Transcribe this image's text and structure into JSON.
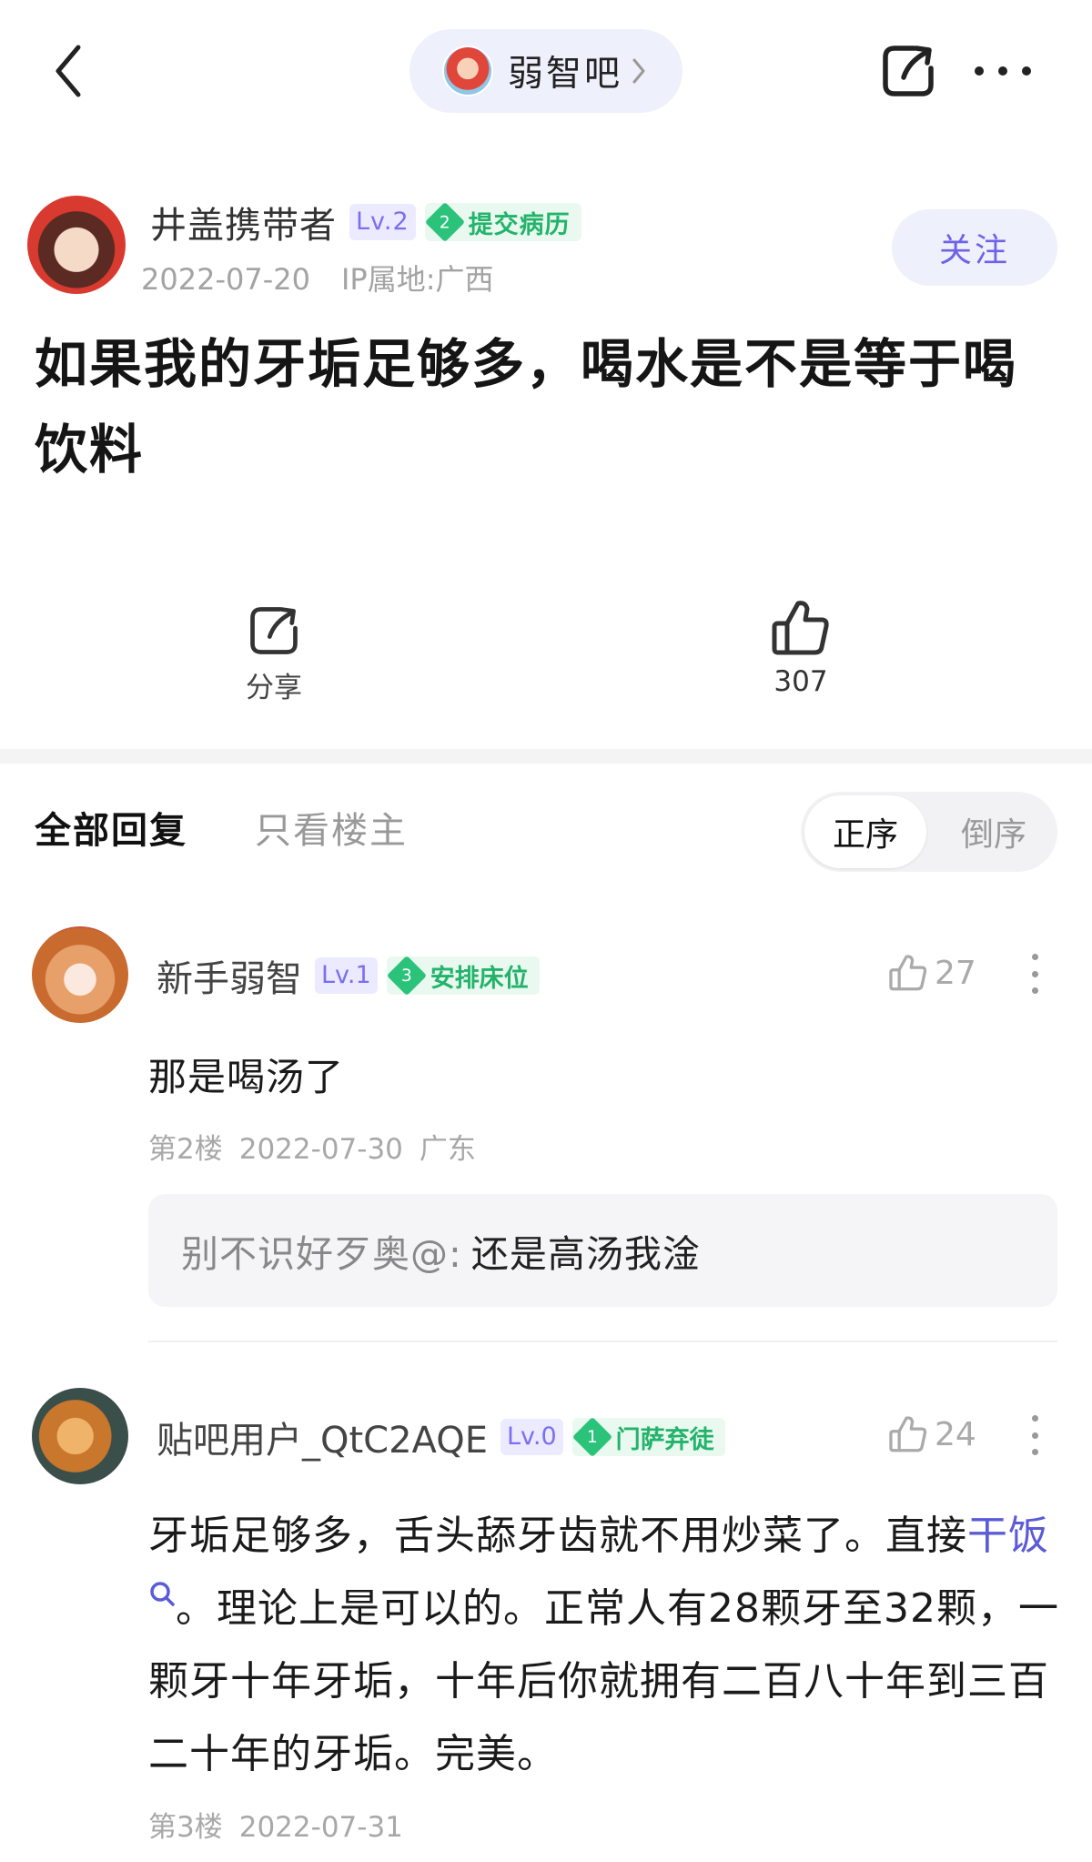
{
  "topbar": {
    "forum_name": "弱智吧"
  },
  "post": {
    "author": "井盖携带者",
    "level": "Lv.2",
    "honor_level": "2",
    "honor_title": "提交病历",
    "date": "2022-07-20",
    "ip": "IP属地:广西",
    "follow_label": "关注",
    "title": "如果我的牙垢足够多，喝水是不是等于喝饮料",
    "share_label": "分享",
    "like_count": "307"
  },
  "replies": {
    "tab_all": "全部回复",
    "tab_owner_only": "只看楼主",
    "sort_asc": "正序",
    "sort_desc": "倒序"
  },
  "comments": [
    {
      "author": "新手弱智",
      "level": "Lv.1",
      "honor_level": "3",
      "honor_title": "安排床位",
      "likes": "27",
      "text": "那是喝汤了",
      "floor": "第2楼",
      "date": "2022-07-30",
      "location": "广东",
      "sub_reply": {
        "author": "别不识好歹奥@:",
        "text": "还是高汤我淦"
      }
    },
    {
      "author": "贴吧用户_QtC2AQE",
      "level": "Lv.0",
      "honor_level": "1",
      "honor_title": "门萨弃徒",
      "likes": "24",
      "text_part1": "牙垢足够多，舌头舔牙齿就不用炒菜了。直接",
      "link_text": "干饭",
      "text_part2": "。理论上是可以的。正常人有28颗牙至32颗，一颗牙十年牙垢，十年后你就拥有二百八十年到三百二十年的牙垢。完美。",
      "floor": "第3楼",
      "date": "2022-07-31"
    }
  ],
  "icons": {
    "back": "chevron-left-icon",
    "forum_chevron": "chevron-right-icon",
    "share": "share-icon",
    "more": "more-horizontal-icon",
    "like": "thumbs-up-icon",
    "comment_more": "more-vertical-icon",
    "search": "search-icon"
  },
  "colors": {
    "accent": "#6e62e9",
    "honor_green": "#23b36b",
    "level_purple": "#7a6ff0",
    "link": "#5b5bd8"
  }
}
